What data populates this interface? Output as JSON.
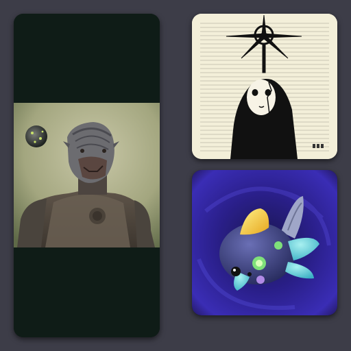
{
  "gallery": {
    "items": [
      {
        "icon": "armored-alien-figure-image"
      },
      {
        "icon": "masked-spirit-illustration-image"
      },
      {
        "icon": "blue-fish-creature-render-image"
      }
    ]
  },
  "colors": {
    "background": "#3d3d48",
    "left_card_bg": "#0f1c17",
    "sketch_paper": "#f3efd9",
    "space_purple": "#2a1f8a"
  }
}
